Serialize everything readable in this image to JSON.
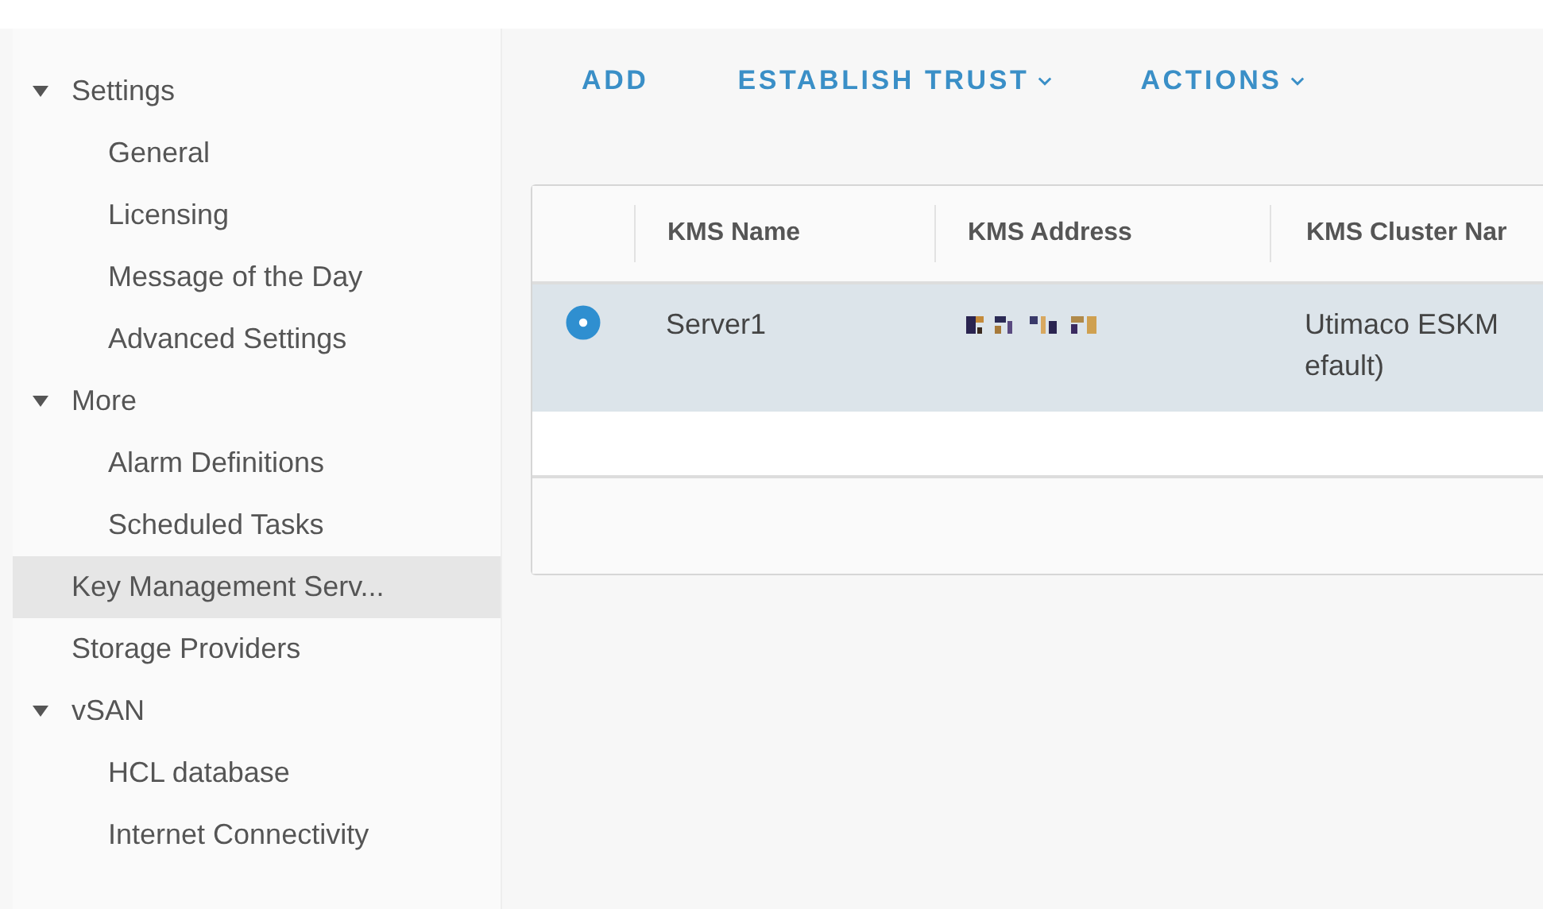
{
  "sidebar": {
    "items": [
      {
        "label": "Settings",
        "expanded": true,
        "selected": false,
        "children": [
          {
            "label": "General",
            "selected": false
          },
          {
            "label": "Licensing",
            "selected": false
          },
          {
            "label": "Message of the Day",
            "selected": false
          },
          {
            "label": "Advanced Settings",
            "selected": false
          }
        ]
      },
      {
        "label": "More",
        "expanded": true,
        "selected": false,
        "children": [
          {
            "label": "Alarm Definitions",
            "selected": false
          },
          {
            "label": "Scheduled Tasks",
            "selected": false
          }
        ]
      },
      {
        "label": "Key Management Serv...",
        "selected": true
      },
      {
        "label": "Storage Providers",
        "selected": false
      },
      {
        "label": "vSAN",
        "expanded": true,
        "selected": false,
        "children": [
          {
            "label": "HCL database",
            "selected": false
          },
          {
            "label": "Internet Connectivity",
            "selected": false
          }
        ]
      }
    ]
  },
  "toolbar": [
    {
      "label": "ADD",
      "dropdown": false
    },
    {
      "label": "ESTABLISH TRUST",
      "dropdown": true
    },
    {
      "label": "ACTIONS",
      "dropdown": true
    }
  ],
  "table": {
    "columns": [
      "KMS Name",
      "KMS Address",
      "KMS Cluster Nar"
    ],
    "rows": [
      {
        "selected": true,
        "name": "Server1",
        "address": {
          "kind": "redacted"
        },
        "cluster": [
          "Utimaco ESKM",
          "efault)"
        ]
      }
    ]
  }
}
